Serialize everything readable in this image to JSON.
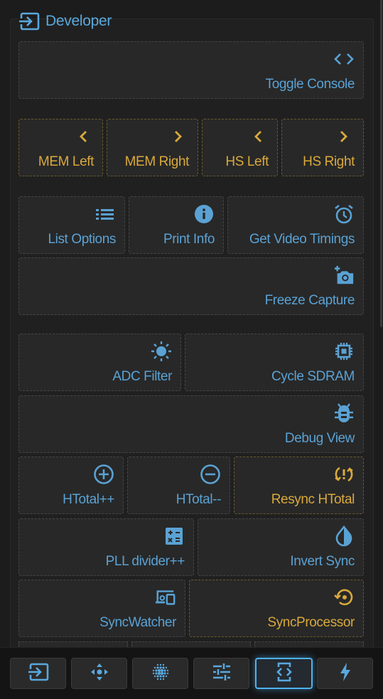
{
  "colors": {
    "accent": "#5aa8dd",
    "gold": "#d9a93c",
    "nav_active": "#4fb2ee"
  },
  "section": {
    "title": "Developer",
    "icon": "input-icon"
  },
  "buttons": {
    "toggle_console": {
      "label": "Toggle Console",
      "icon": "code-icon"
    },
    "mem_left": {
      "label": "MEM Left",
      "icon": "chevron-left-icon"
    },
    "mem_right": {
      "label": "MEM Right",
      "icon": "chevron-right-icon"
    },
    "hs_left": {
      "label": "HS Left",
      "icon": "chevron-left-icon"
    },
    "hs_right": {
      "label": "HS Right",
      "icon": "chevron-right-icon"
    },
    "list_options": {
      "label": "List Options",
      "icon": "list-icon"
    },
    "print_info": {
      "label": "Print Info",
      "icon": "info-icon"
    },
    "get_video_timings": {
      "label": "Get Video Timings",
      "icon": "alarm-icon"
    },
    "freeze_capture": {
      "label": "Freeze Capture",
      "icon": "add-camera-icon"
    },
    "adc_filter": {
      "label": "ADC Filter",
      "icon": "brightness-icon"
    },
    "cycle_sdram": {
      "label": "Cycle SDRAM",
      "icon": "memory-icon"
    },
    "debug_view": {
      "label": "Debug View",
      "icon": "bug-icon"
    },
    "htotal_plus": {
      "label": "HTotal++",
      "icon": "plus-circle-icon"
    },
    "htotal_minus": {
      "label": "HTotal--",
      "icon": "minus-circle-icon"
    },
    "resync_htotal": {
      "label": "Resync HTotal",
      "icon": "sync-problem-icon"
    },
    "pll_divider": {
      "label": "PLL divider++",
      "icon": "calculator-icon"
    },
    "invert_sync": {
      "label": "Invert Sync",
      "icon": "invert-colors-icon"
    },
    "sync_watcher": {
      "label": "SyncWatcher",
      "icon": "devices-icon"
    },
    "sync_processor": {
      "label": "SyncProcessor",
      "icon": "settings-backup-restore-icon"
    }
  },
  "nav": [
    {
      "name": "input-icon",
      "active": false
    },
    {
      "name": "move-icon",
      "active": false
    },
    {
      "name": "grid-dots-icon",
      "active": false
    },
    {
      "name": "sliders-icon",
      "active": false
    },
    {
      "name": "developer-mode-icon",
      "active": true
    },
    {
      "name": "bolt-icon",
      "active": false
    }
  ]
}
